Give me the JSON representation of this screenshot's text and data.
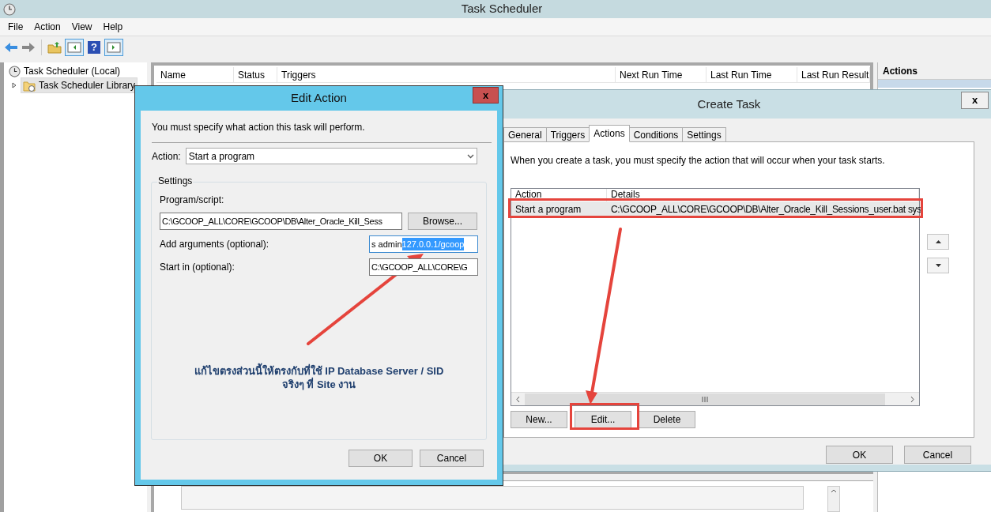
{
  "window": {
    "title": "Task Scheduler"
  },
  "menu": [
    "File",
    "Action",
    "View",
    "Help"
  ],
  "toolbar": {
    "help": "?"
  },
  "tree": [
    {
      "label": "Task Scheduler (Local)",
      "selected": false,
      "children": [
        {
          "label": "Task Scheduler Library",
          "selected": true,
          "expanded": false
        }
      ]
    }
  ],
  "task_table": {
    "columns": [
      "Name",
      "Status",
      "Triggers",
      "Next Run Time",
      "Last Run Time",
      "Last Run Result"
    ]
  },
  "actions_panel": {
    "title": "Actions"
  },
  "create_task": {
    "title": "Create Task",
    "close": "x",
    "tabs": [
      {
        "label": "General",
        "selected": false
      },
      {
        "label": "Triggers",
        "selected": false
      },
      {
        "label": "Actions",
        "selected": true
      },
      {
        "label": "Conditions",
        "selected": false
      },
      {
        "label": "Settings",
        "selected": false
      }
    ],
    "description": "When you create a task, you must specify the action that will occur when your task starts.",
    "actions_table": {
      "columns": [
        "Action",
        "Details"
      ],
      "rows": [
        {
          "action": "Start a program",
          "details": "C:\\GCOOP_ALL\\CORE\\GCOOP\\DB\\Alter_Oracle_Kill_Sessions_user.bat sys",
          "selected": true
        }
      ]
    },
    "list_buttons": [
      "New...",
      "Edit...",
      "Delete"
    ],
    "dialog_buttons": [
      "OK",
      "Cancel"
    ]
  },
  "edit_action": {
    "title": "Edit Action",
    "close": "x",
    "instruction": "You must specify what action this task will perform.",
    "action_label": "Action:",
    "action_value": "Start a program",
    "group": "Settings",
    "program_label": "Program/script:",
    "program_value": "C:\\GCOOP_ALL\\CORE\\GCOOP\\DB\\Alter_Oracle_Kill_Sess",
    "browse": "Browse...",
    "arguments_label": "Add arguments (optional):",
    "arguments_value": "s admin ",
    "arguments_selected_text": "127.0.0.1/gcoop",
    "start_label": "Start in (optional):",
    "start_value": "C:\\GCOOP_ALL\\CORE\\G",
    "buttons": [
      "OK",
      "Cancel"
    ]
  },
  "annotation": [
    "แก้ไขตรงส่วนนี้ให้ตรงกับที่ใช้ IP Database Server / SID",
    "จริงๆ ที่ Site งาน"
  ]
}
